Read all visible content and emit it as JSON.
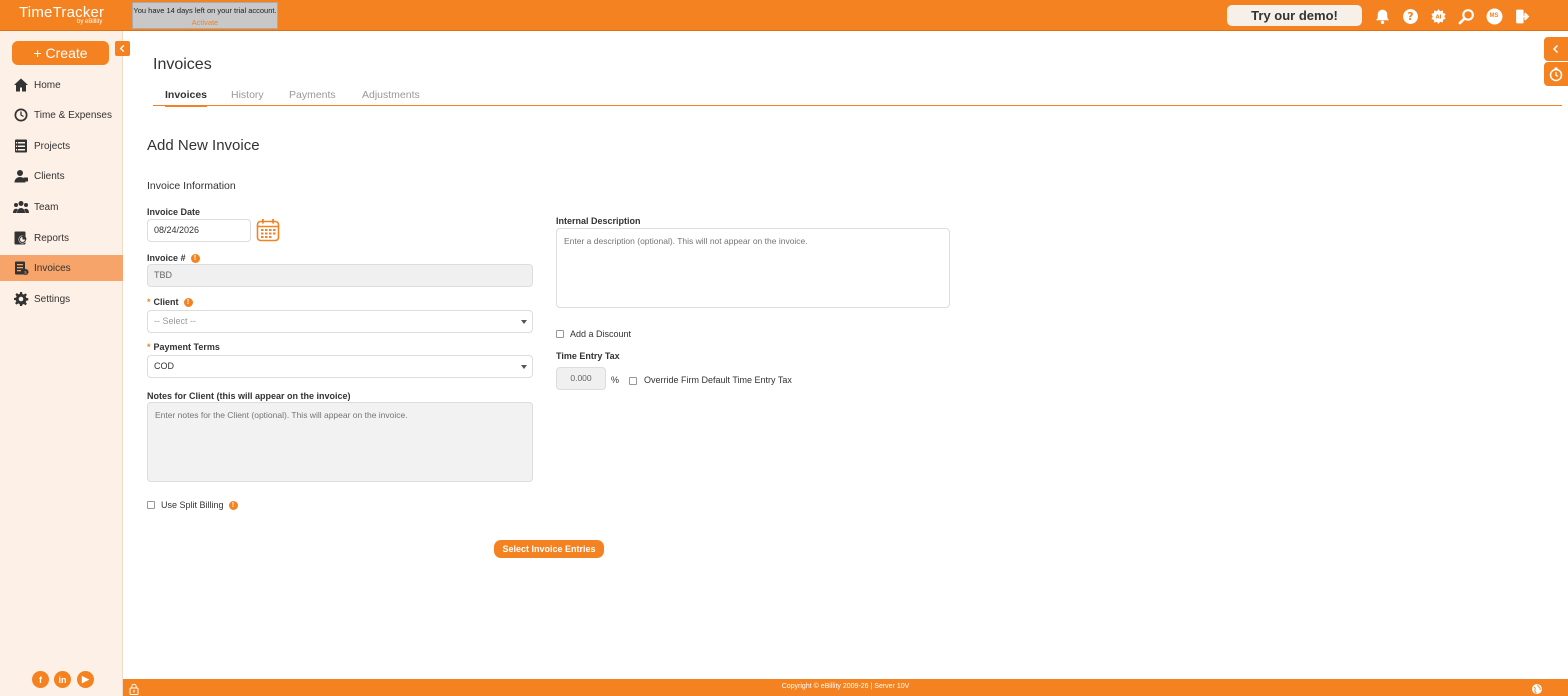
{
  "app": {
    "name": "TimeTracker",
    "sub": "by eBillity"
  },
  "trial": {
    "message": "You have 14 days left on your trial account.",
    "link": "Activate"
  },
  "header": {
    "demo_label": "Try our demo!",
    "avatar_initials": "MS",
    "icons": [
      "bell-icon",
      "help-icon",
      "ai-icon",
      "search-icon",
      "avatar",
      "logout-icon"
    ]
  },
  "sidebar": {
    "create_label": "+ Create",
    "items": [
      {
        "label": "Home",
        "icon": "home-icon"
      },
      {
        "label": "Time & Expenses",
        "icon": "clock-icon"
      },
      {
        "label": "Projects",
        "icon": "projects-icon"
      },
      {
        "label": "Clients",
        "icon": "clients-icon"
      },
      {
        "label": "Team",
        "icon": "team-icon"
      },
      {
        "label": "Reports",
        "icon": "reports-icon"
      },
      {
        "label": "Invoices",
        "icon": "invoices-icon",
        "active": true
      },
      {
        "label": "Settings",
        "icon": "gear-icon"
      }
    ],
    "social": [
      "f",
      "in",
      "▶"
    ]
  },
  "page": {
    "title": "Invoices",
    "tabs": [
      "Invoices",
      "History",
      "Payments",
      "Adjustments"
    ],
    "active_tab": "Invoices"
  },
  "form": {
    "title": "Add New Invoice",
    "section": "Invoice Information",
    "invoice_date": {
      "label": "Invoice Date",
      "value": "08/24/2026"
    },
    "invoice_number": {
      "label": "Invoice #",
      "value": "TBD"
    },
    "client": {
      "label": "Client",
      "value": "-- Select --"
    },
    "payment_terms": {
      "label": "Payment Terms",
      "value": "COD"
    },
    "notes": {
      "label": "Notes for Client (this will appear on the invoice)",
      "placeholder": "Enter notes for the Client (optional). This will appear on the invoice."
    },
    "split_billing": {
      "label": "Use Split Billing"
    },
    "internal_description": {
      "label": "Internal Description",
      "placeholder": "Enter a description (optional). This will not appear on the invoice."
    },
    "discount": {
      "label": "Add a Discount"
    },
    "time_entry_tax": {
      "label": "Time Entry Tax",
      "value": "0.000",
      "unit": "%",
      "override_label": "Override Firm Default Time Entry Tax"
    },
    "submit_label": "Select Invoice Entries"
  },
  "footer": {
    "copyright": "Copyright © eBillity 2009-26  |  Server 10V"
  },
  "colors": {
    "accent": "#f58220",
    "sidebar_bg": "#fdf0e6",
    "active_item": "#f6a46a"
  }
}
